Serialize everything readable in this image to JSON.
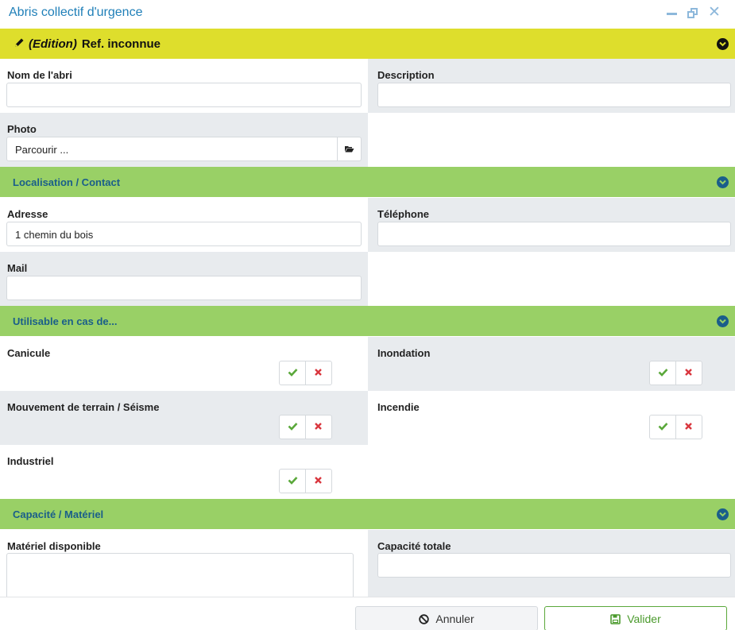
{
  "window": {
    "title": "Abris collectif d'urgence"
  },
  "header": {
    "edition_label": "(Edition)",
    "ref_label": "Ref. inconnue"
  },
  "general": {
    "nom_label": "Nom de l'abri",
    "nom_value": "",
    "description_label": "Description",
    "description_value": "",
    "photo_label": "Photo",
    "photo_value": "Parcourir ..."
  },
  "localisation": {
    "section_label": "Localisation / Contact",
    "adresse_label": "Adresse",
    "adresse_value": "1  chemin du bois",
    "telephone_label": "Téléphone",
    "telephone_value": "",
    "mail_label": "Mail",
    "mail_value": ""
  },
  "utilisable": {
    "section_label": "Utilisable en cas de...",
    "canicule_label": "Canicule",
    "inondation_label": "Inondation",
    "mouvement_label": "Mouvement de terrain / Séisme",
    "incendie_label": "Incendie",
    "industriel_label": "Industriel"
  },
  "capacite": {
    "section_label": "Capacité / Matériel",
    "materiel_label": "Matériel disponible",
    "materiel_value": "",
    "capacite_label": "Capacité totale",
    "capacite_value": ""
  },
  "footer": {
    "cancel_label": "Annuler",
    "ok_label": "Valider"
  },
  "colors": {
    "title_blue": "#1f7fb8",
    "section_yellow": "#dede2c",
    "section_green": "#99d066",
    "section_text": "#1a5e8a",
    "check_green": "#5aa83a",
    "cross_red": "#d9363e"
  },
  "icons": {
    "edit": "pencil-icon",
    "collapse": "chevron-down-circle-icon",
    "browse": "folder-open-icon",
    "yes": "check-icon",
    "no": "times-icon",
    "cancel": "ban-icon",
    "save": "floppy-disk-icon"
  }
}
